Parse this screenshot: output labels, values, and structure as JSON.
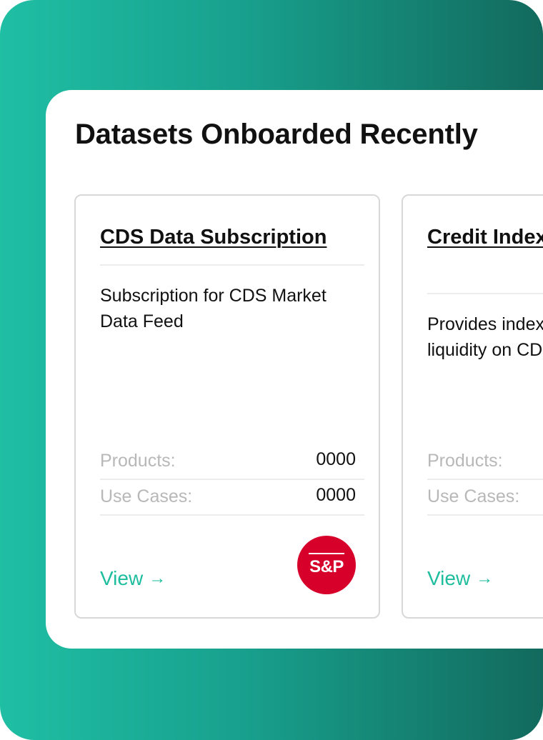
{
  "section": {
    "title": "Datasets Onboarded Recently"
  },
  "cards": [
    {
      "title": "CDS Data Subscription",
      "description": "Subscription for CDS Market Data Feed",
      "products_label": "Products:",
      "products_value": "0000",
      "use_cases_label": "Use Cases:",
      "use_cases_value": "0000",
      "view_label": "View",
      "arrow": "→",
      "logo_text": "S&P"
    },
    {
      "title": "Credit Index Pricing",
      "description": "Provides index pricing and liquidity on CDS single names",
      "products_label": "Products:",
      "use_cases_label": "Use Cases:",
      "view_label": "View",
      "arrow": "→"
    }
  ],
  "colors": {
    "accent": "#1dbd9d",
    "gradient_start": "#1fbfa4",
    "gradient_end": "#126a5d",
    "logo_red": "#d6002a"
  }
}
